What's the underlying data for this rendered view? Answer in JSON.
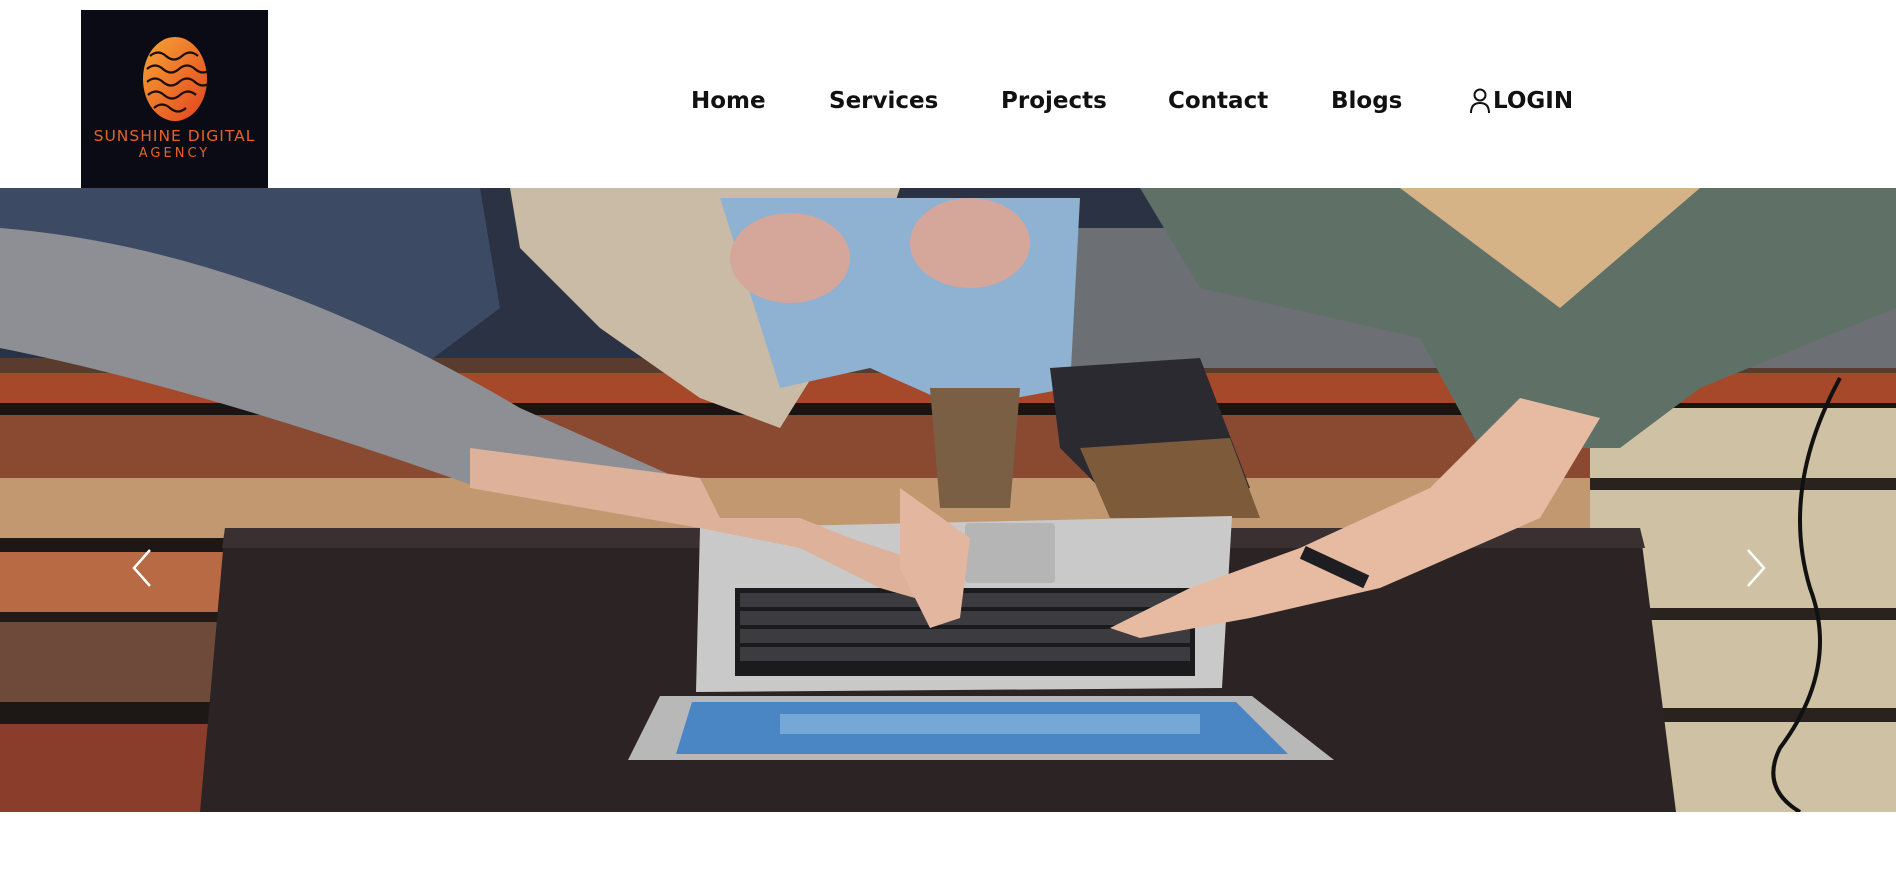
{
  "brand": {
    "name_line1": "SUNSHINE DIGITAL",
    "name_line2": "AGENCY",
    "logo_bg": "#0b0b16",
    "logo_accent": "#e7622a"
  },
  "nav": {
    "items": [
      {
        "label": "Home"
      },
      {
        "label": "Services"
      },
      {
        "label": "Projects"
      },
      {
        "label": "Contact"
      },
      {
        "label": "Blogs"
      }
    ],
    "login_label": "LOGIN",
    "login_icon": "user-icon"
  },
  "carousel": {
    "prev_icon": "chevron-left-icon",
    "next_icon": "chevron-right-icon",
    "slide_description_icon": "hero-photo"
  }
}
